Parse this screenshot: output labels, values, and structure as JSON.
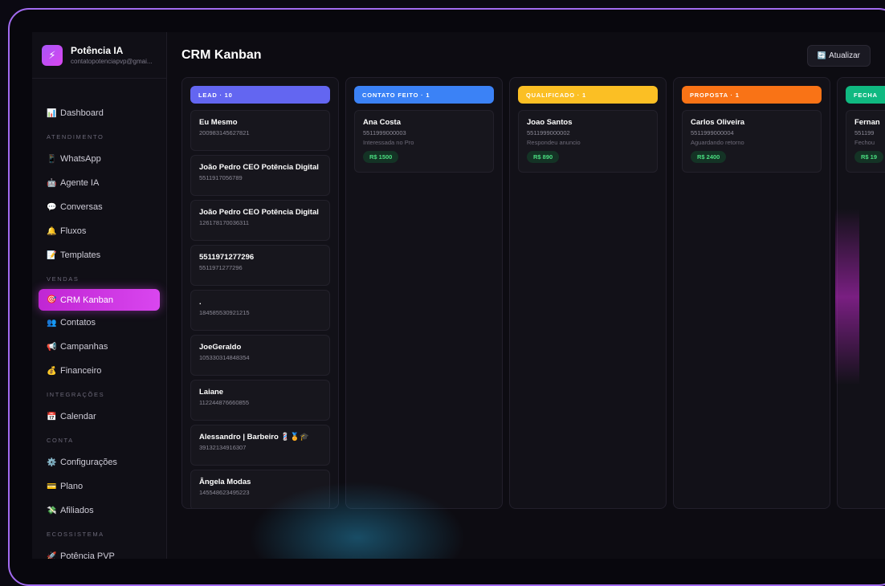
{
  "brand": {
    "name": "Potência IA",
    "email": "contatopotenciapvp@gmai...",
    "logo_icon": "⚡"
  },
  "nav": {
    "dashboard": {
      "icon": "📊",
      "label": "Dashboard"
    },
    "sec_atendimento": "ATENDIMENTO",
    "whatsapp": {
      "icon": "📱",
      "label": "WhatsApp"
    },
    "agente": {
      "icon": "🤖",
      "label": "Agente IA"
    },
    "conversas": {
      "icon": "💬",
      "label": "Conversas"
    },
    "fluxos": {
      "icon": "🔔",
      "label": "Fluxos"
    },
    "templates": {
      "icon": "📝",
      "label": "Templates"
    },
    "sec_vendas": "VENDAS",
    "crm": {
      "icon": "🎯",
      "label": "CRM Kanban"
    },
    "contatos": {
      "icon": "👥",
      "label": "Contatos"
    },
    "campanhas": {
      "icon": "📢",
      "label": "Campanhas"
    },
    "financeiro": {
      "icon": "💰",
      "label": "Financeiro"
    },
    "sec_integracoes": "INTEGRAÇÕES",
    "calendar": {
      "icon": "📅",
      "label": "Calendar"
    },
    "sec_conta": "CONTA",
    "config": {
      "icon": "⚙️",
      "label": "Configurações"
    },
    "plano": {
      "icon": "💳",
      "label": "Plano"
    },
    "afiliados": {
      "icon": "💸",
      "label": "Afiliados"
    },
    "sec_ecossistema": "ECOSSISTEMA",
    "pvp": {
      "icon": "🚀",
      "label": "Potência PVP"
    }
  },
  "header": {
    "title": "CRM Kanban",
    "refresh_icon": "🔄",
    "refresh_label": "Atualizar"
  },
  "colors": {
    "lead": "#6366f1",
    "contato": "#3b82f6",
    "qualificado": "#fbbf24",
    "proposta": "#f97316",
    "fechado": "#10b981",
    "accent": "#d946ef"
  },
  "columns": {
    "lead": {
      "title": "LEAD · 10",
      "cards": [
        {
          "name": "Eu Mesmo",
          "phone": "200983145627821"
        },
        {
          "name": "João Pedro CEO Potência Digital",
          "phone": "5511917056789"
        },
        {
          "name": "João Pedro CEO Potência Digital",
          "phone": "126178170036311"
        },
        {
          "name": "5511971277296",
          "phone": "5511971277296"
        },
        {
          "name": ".",
          "phone": "184585530921215"
        },
        {
          "name": "JoeGeraldo",
          "phone": "105330314848354"
        },
        {
          "name": "Laiane",
          "phone": "112244876660855"
        },
        {
          "name": "Alessandro | Barbeiro 💈🏅🎓",
          "phone": "39132134916307"
        },
        {
          "name": "Ângela Modas",
          "phone": "145548623495223"
        }
      ]
    },
    "contato": {
      "title": "CONTATO FEITO · 1",
      "cards": [
        {
          "name": "Ana Costa",
          "phone": "5511999000003",
          "note": "Interessada no Pro",
          "value": "R$ 1500"
        }
      ]
    },
    "qualificado": {
      "title": "QUALIFICADO · 1",
      "cards": [
        {
          "name": "Joao Santos",
          "phone": "5511999000002",
          "note": "Respondeu anuncio",
          "value": "R$ 890"
        }
      ]
    },
    "proposta": {
      "title": "PROPOSTA · 1",
      "cards": [
        {
          "name": "Carlos Oliveira",
          "phone": "5511999000004",
          "note": "Aguardando retorno",
          "value": "R$ 2400"
        }
      ]
    },
    "fechado": {
      "title": "FECHA",
      "cards": [
        {
          "name": "Fernan",
          "phone": "551199",
          "note": "Fechou",
          "value": "R$ 19"
        }
      ]
    }
  }
}
